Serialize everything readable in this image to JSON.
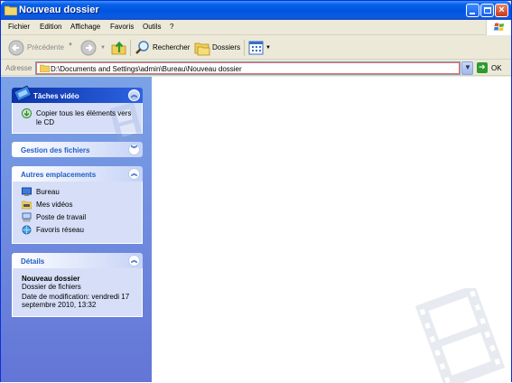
{
  "window": {
    "title": "Nouveau dossier",
    "title_icon": "folder-icon",
    "controls": {
      "minimize": "minimize-icon",
      "maximize": "maximize-icon",
      "close": "×"
    }
  },
  "menu": {
    "items": [
      "Fichier",
      "Edition",
      "Affichage",
      "Favoris",
      "Outils",
      "?"
    ]
  },
  "toolbar": {
    "back_label": "Précédente",
    "search_label": "Rechercher",
    "folders_label": "Dossiers"
  },
  "address": {
    "label": "Adresse",
    "path": "D:\\Documents and Settings\\admin\\Bureau\\Nouveau dossier",
    "go_label": "OK"
  },
  "taskpane": {
    "video": {
      "title": "Tâches vidéo",
      "tasks": [
        {
          "line1": "Copier tous les éléments vers",
          "line2": "le CD",
          "icon": "copy-to-cd-icon"
        }
      ]
    },
    "files": {
      "title": "Gestion des fichiers"
    },
    "places": {
      "title": "Autres emplacements",
      "items": [
        {
          "label": "Bureau",
          "icon": "desktop-icon"
        },
        {
          "label": "Mes vidéos",
          "icon": "my-videos-icon"
        },
        {
          "label": "Poste de travail",
          "icon": "my-computer-icon"
        },
        {
          "label": "Favoris réseau",
          "icon": "network-places-icon"
        }
      ]
    },
    "details": {
      "title": "Détails",
      "name": "Nouveau dossier",
      "type": "Dossier de fichiers",
      "modified_line1": "Date de modification: vendredi 17",
      "modified_line2": "septembre 2010, 13:32"
    }
  },
  "colors": {
    "titlebar": "#0054e3",
    "taskpane": "#6f8fdf",
    "link": "#215dc6"
  }
}
